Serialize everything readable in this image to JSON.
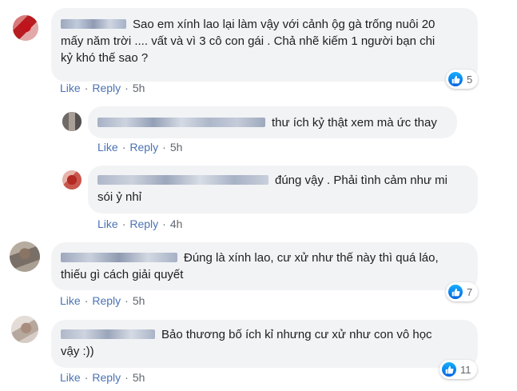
{
  "colors": {
    "bubble_bg": "#f2f3f5",
    "action_link": "#4b73b4",
    "meta_text": "#606770",
    "like_blue": "#1877f2"
  },
  "comments": [
    {
      "text_lines": [
        "Sao em xính lao lại làm vậy với cảnh ộg gà trống nuôi 20",
        "mấy năm trời .... vất và vì 3 cô con gái . Chả nhẽ kiếm 1 người bạn chi",
        "kỷ khó thế sao ?"
      ],
      "like": "Like",
      "reply": "Reply",
      "time": "5h",
      "reaction_count": "5",
      "reaction_icon": "like-thumb-icon"
    },
    {
      "text_lines": [
        "thư ích kỷ thật xem mà ức thay"
      ],
      "like": "Like",
      "reply": "Reply",
      "time": "5h"
    },
    {
      "text_lines": [
        "đúng vậy . Phải tình cảm như mi",
        "sói ỷ nhỉ"
      ],
      "like": "Like",
      "reply": "Reply",
      "time": "4h"
    },
    {
      "text_lines": [
        "Đúng là xính lao, cư xử như thế này thì quá láo,",
        "thiếu gì cách giải quyết"
      ],
      "like": "Like",
      "reply": "Reply",
      "time": "5h",
      "reaction_count": "7",
      "reaction_icon": "like-thumb-icon"
    },
    {
      "text_lines": [
        "Bảo thương bố ích kỉ nhưng cư xử như con vô học",
        "vậy :))"
      ],
      "like": "Like",
      "reply": "Reply",
      "time": "5h",
      "reaction_count": "11",
      "reaction_icon": "like-thumb-icon"
    }
  ]
}
